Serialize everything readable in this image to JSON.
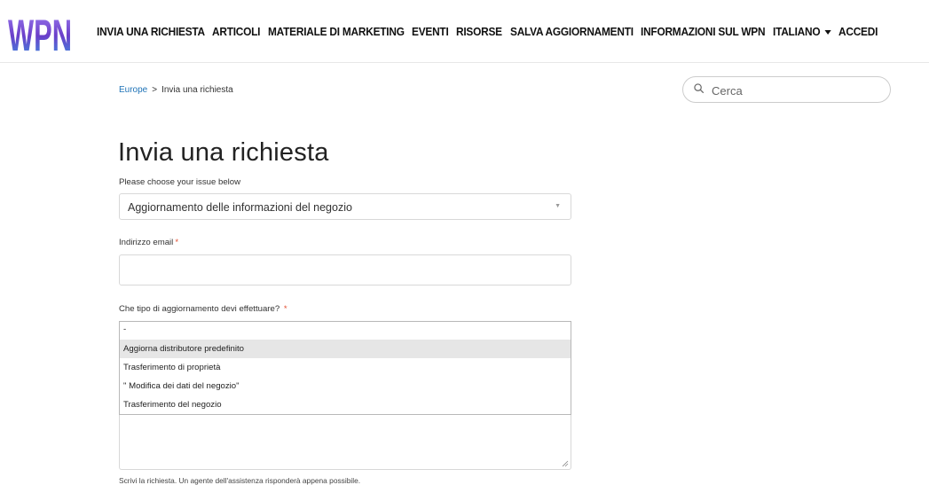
{
  "brand": {
    "logo_text": "WPN"
  },
  "nav": {
    "items": [
      "INVIA UNA RICHIESTA",
      "ARTICOLI",
      "MATERIALE DI MARKETING",
      "EVENTI",
      "RISORSE",
      "SALVA AGGIORNAMENTI",
      "INFORMAZIONI SUL WPN"
    ],
    "language": "ITALIANO",
    "signin": "ACCEDI"
  },
  "breadcrumb": {
    "root": "Europe",
    "separator": ">",
    "current": "Invia una richiesta"
  },
  "search": {
    "placeholder": "Cerca"
  },
  "form": {
    "title": "Invia una richiesta",
    "issue_label": "Please choose your issue below",
    "issue_value": "Aggiornamento delle informazioni del negozio",
    "email_label": "Indirizzo email",
    "email_value": "",
    "update_type_label": "Che tipo di aggiornamento devi effettuare?",
    "required_mark": "*",
    "update_type_options": [
      "-",
      "Aggiorna distributore predefinito",
      "Trasferimento di proprietà",
      "\" Modifica dei dati del negozio\"",
      "Trasferimento del negozio"
    ],
    "highlighted_option_index": 1,
    "description_hint": "Scrivi la richiesta. Un agente dell'assistenza risponderà appena possibile."
  },
  "colors": {
    "link": "#1f73b7",
    "required": "#e34f32",
    "logo_purple": "#6b3fc9",
    "logo_blue": "#3a8fe0"
  }
}
